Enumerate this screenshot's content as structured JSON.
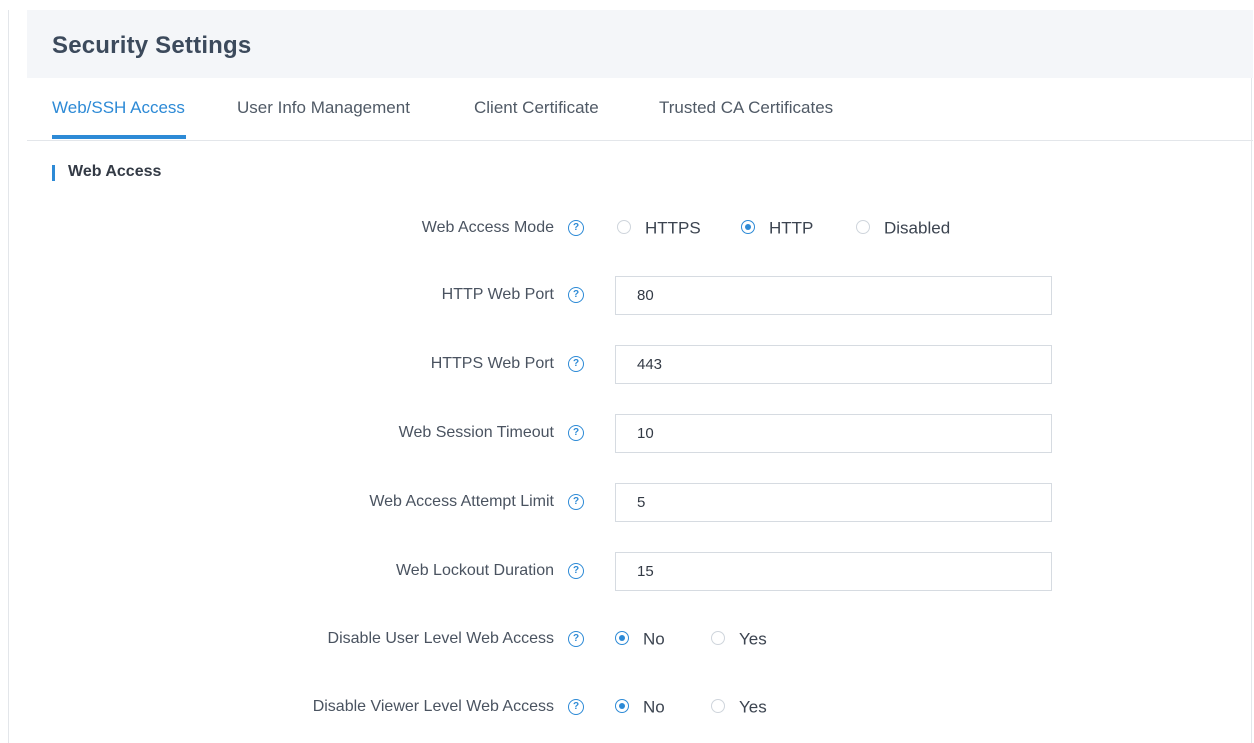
{
  "page": {
    "title": "Security Settings"
  },
  "tabs": [
    {
      "label": "Web/SSH Access",
      "active": true
    },
    {
      "label": "User Info Management",
      "active": false
    },
    {
      "label": "Client Certificate",
      "active": false
    },
    {
      "label": "Trusted CA Certificates",
      "active": false
    }
  ],
  "section": {
    "title": "Web Access"
  },
  "form": {
    "web_access_mode": {
      "label": "Web Access Mode",
      "options": [
        "HTTPS",
        "HTTP",
        "Disabled"
      ],
      "selected": "HTTP"
    },
    "http_web_port": {
      "label": "HTTP Web Port",
      "value": "80"
    },
    "https_web_port": {
      "label": "HTTPS Web Port",
      "value": "443"
    },
    "web_session_timeout": {
      "label": "Web Session Timeout",
      "value": "10"
    },
    "web_access_attempt_limit": {
      "label": "Web Access Attempt Limit",
      "value": "5"
    },
    "web_lockout_duration": {
      "label": "Web Lockout Duration",
      "value": "15"
    },
    "disable_user_level_web_access": {
      "label": "Disable User Level Web Access",
      "options": [
        "No",
        "Yes"
      ],
      "selected": "No"
    },
    "disable_viewer_level_web_access": {
      "label": "Disable Viewer Level Web Access",
      "options": [
        "No",
        "Yes"
      ],
      "selected": "No"
    }
  },
  "icons": {
    "help": "question-circle-icon"
  },
  "colors": {
    "accent": "#2d8ad6",
    "header_bg": "#f4f6f9",
    "title": "#3c4a5c"
  }
}
